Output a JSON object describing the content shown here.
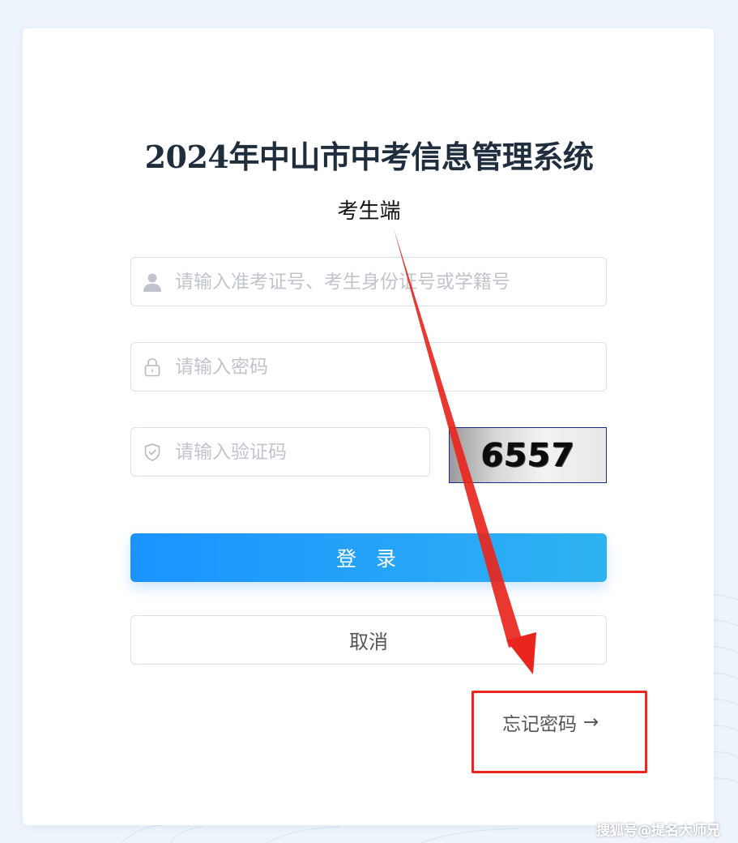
{
  "header": {
    "title": "2024年中山市中考信息管理系统",
    "subtitle": "考生端"
  },
  "form": {
    "username_placeholder": "请输入准考证号、考生身份证号或学籍号",
    "password_placeholder": "请输入密码",
    "code_placeholder": "请输入验证码",
    "captcha_text": "6557",
    "username_icon": "user-icon",
    "password_icon": "lock-icon",
    "code_icon": "shield-icon"
  },
  "actions": {
    "login_label": "登 录",
    "cancel_label": "取消",
    "forgot_label": "忘记密码",
    "forgot_arrow": "→"
  },
  "annotation": {
    "color": "#e8261e"
  },
  "watermark": "搜狐号@提名大师兄",
  "colors": {
    "accent": "#1a93ff",
    "background": "#eef4fb"
  }
}
